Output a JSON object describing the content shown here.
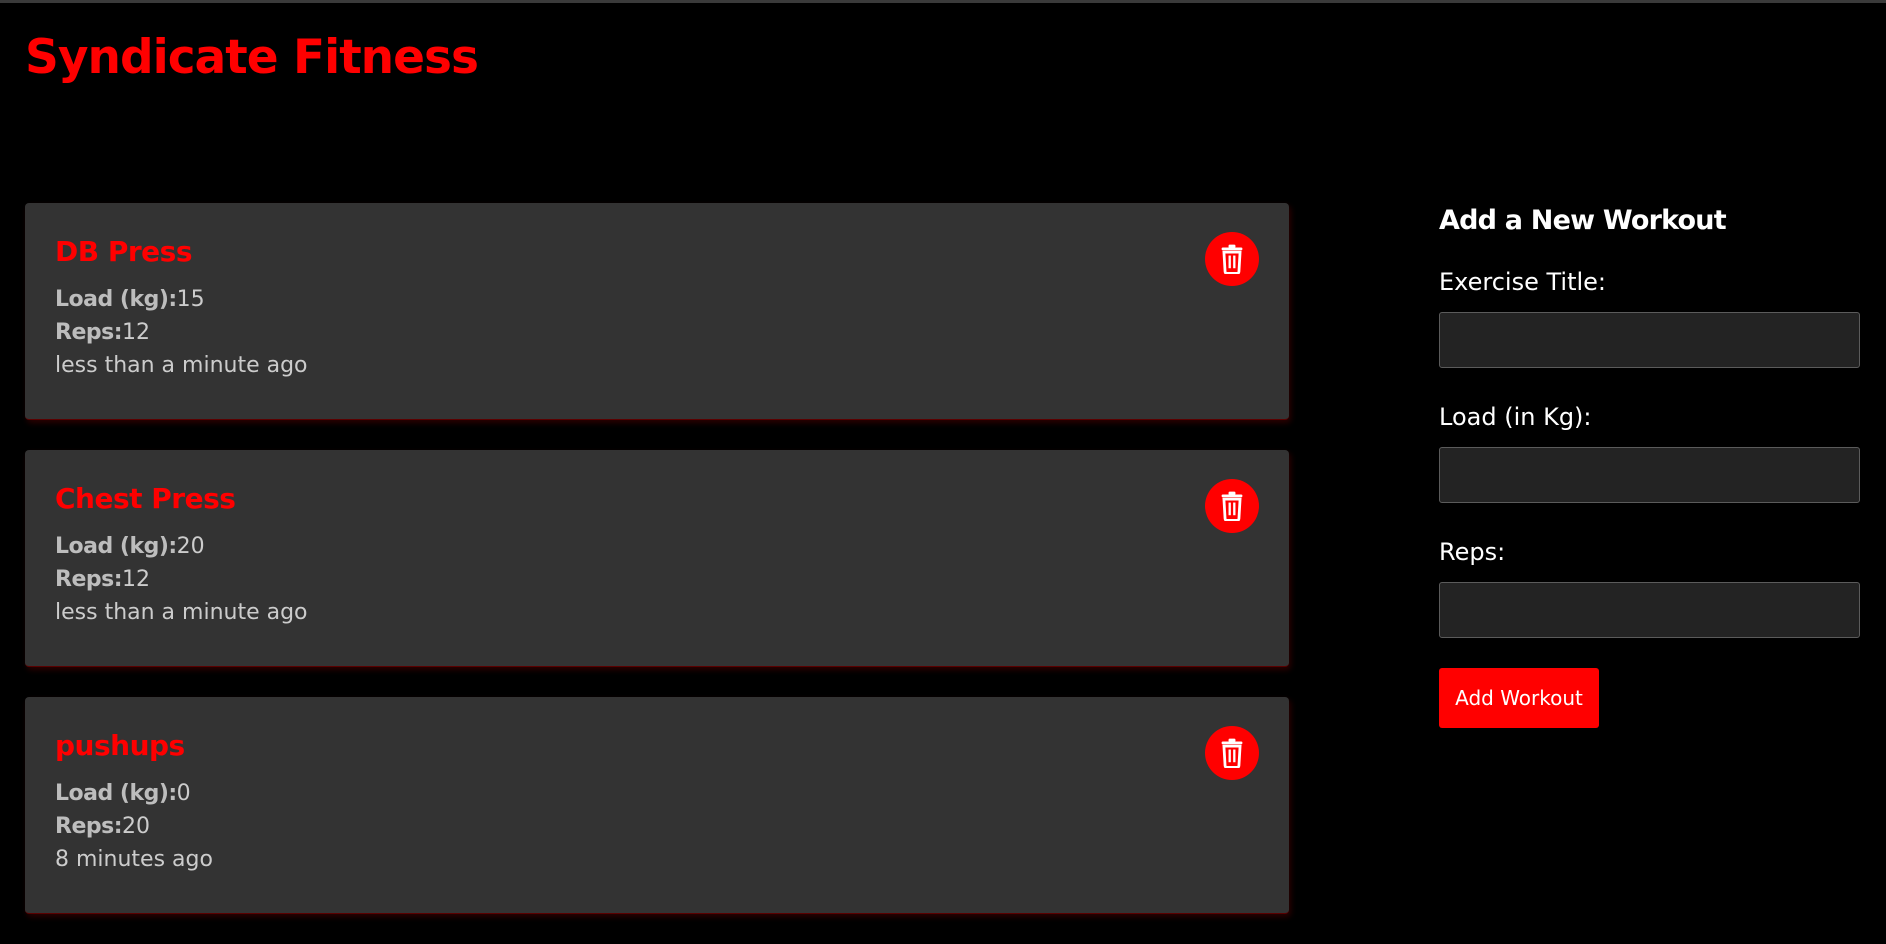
{
  "app": {
    "title": "Syndicate Fitness",
    "accent_color": "#ff0000"
  },
  "workouts": [
    {
      "title": "DB Press",
      "load_label": "Load (kg):",
      "load": "15",
      "reps_label": "Reps:",
      "reps": "12",
      "time": "less than a minute ago",
      "delete_icon": "trash-icon"
    },
    {
      "title": "Chest Press",
      "load_label": "Load (kg):",
      "load": "20",
      "reps_label": "Reps:",
      "reps": "12",
      "time": "less than a minute ago",
      "delete_icon": "trash-icon"
    },
    {
      "title": "pushups",
      "load_label": "Load (kg):",
      "load": "0",
      "reps_label": "Reps:",
      "reps": "20",
      "time": "8 minutes ago",
      "delete_icon": "trash-icon"
    }
  ],
  "form": {
    "heading": "Add a New Workout",
    "title_label": "Exercise Title:",
    "title_value": "",
    "load_label": "Load (in Kg):",
    "load_value": "",
    "reps_label": "Reps:",
    "reps_value": "",
    "submit_label": "Add Workout"
  }
}
